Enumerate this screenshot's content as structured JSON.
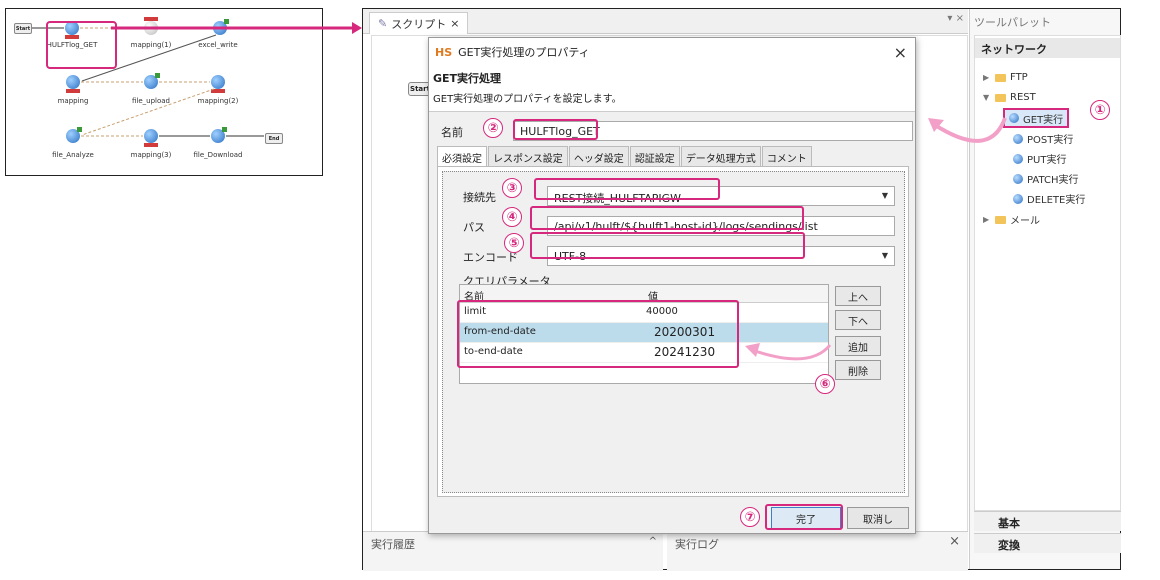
{
  "thumbnail": {
    "nodes": [
      {
        "id": "start",
        "label": "Start"
      },
      {
        "id": "hulft",
        "label": "HULFTlog_GET"
      },
      {
        "id": "map1",
        "label": "mapping(1)"
      },
      {
        "id": "excel",
        "label": "excel_write"
      },
      {
        "id": "map",
        "label": "mapping"
      },
      {
        "id": "upload",
        "label": "file_upload"
      },
      {
        "id": "map2",
        "label": "mapping(2)"
      },
      {
        "id": "analyze",
        "label": "file_Analyze"
      },
      {
        "id": "map3",
        "label": "mapping(3)"
      },
      {
        "id": "download",
        "label": "file_Download"
      },
      {
        "id": "end",
        "label": "End"
      }
    ]
  },
  "main": {
    "tab_label": "スクリプト",
    "tab_close": "×",
    "start_label": "Start",
    "history_label": "実行履歴",
    "log_label": "実行ログ",
    "window_controls": "▾ ×",
    "log_close": "×",
    "history_collapse": "^"
  },
  "palette": {
    "title": "ツールパレット",
    "section": "ネットワーク",
    "items": [
      {
        "label": "FTP",
        "type": "folder"
      },
      {
        "label": "REST",
        "type": "folder"
      },
      {
        "label": "GET実行",
        "type": "item"
      },
      {
        "label": "POST実行",
        "type": "item"
      },
      {
        "label": "PUT実行",
        "type": "item"
      },
      {
        "label": "PATCH実行",
        "type": "item"
      },
      {
        "label": "DELETE実行",
        "type": "item"
      },
      {
        "label": "メール",
        "type": "folder"
      }
    ],
    "bottom_tabs": [
      "基本",
      "変換"
    ]
  },
  "dialog": {
    "logo": "HS",
    "title": "GET実行処理のプロパティ",
    "close": "×",
    "heading": "GET実行処理",
    "description": "GET実行処理のプロパティを設定します。",
    "name_label": "名前",
    "name_value": "HULFTlog_GET",
    "tabs": [
      "必須設定",
      "レスポンス設定",
      "ヘッダ設定",
      "認証設定",
      "データ処理方式",
      "コメント"
    ],
    "connection_label": "接続先",
    "connection_value": "REST接続_HULFTAPIGW",
    "path_label": "パス",
    "path_value": "/api/v1/hulft/${hulft1-host-id}/logs/sendings/list",
    "encode_label": "エンコード",
    "encode_value": "UTF-8",
    "query_label": "クエリパラメータ",
    "query_headers": [
      "名前",
      "値"
    ],
    "query_rows": [
      {
        "name": "limit",
        "value": "40000"
      },
      {
        "name": "from-end-date",
        "value": "20200301"
      },
      {
        "name": "to-end-date",
        "value": "20241230"
      }
    ],
    "side_buttons": [
      "上へ",
      "下へ",
      "追加",
      "削除"
    ],
    "ok_label": "完了",
    "cancel_label": "取消し"
  },
  "annotations": [
    "①",
    "②",
    "③",
    "④",
    "⑤",
    "⑥",
    "⑦"
  ],
  "colors": {
    "highlight": "#d6287d",
    "accent_orange": "#e07a1f",
    "selection": "#bcdcec"
  }
}
